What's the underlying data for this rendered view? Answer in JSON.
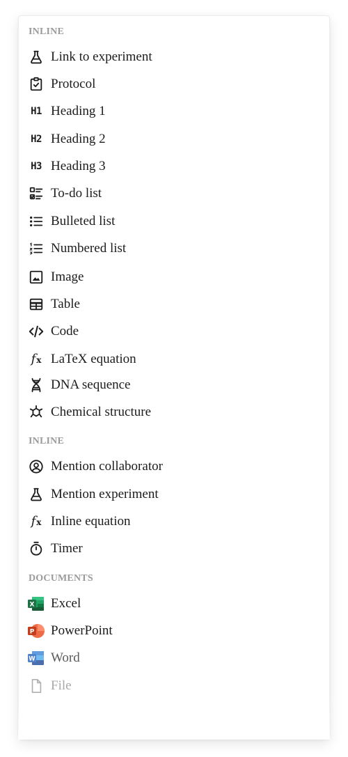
{
  "sections": {
    "inline_1": "INLINE",
    "inline_2": "INLINE",
    "documents": "DOCUMENTS"
  },
  "items": {
    "link_experiment": "Link to experiment",
    "protocol": "Protocol",
    "heading1": "Heading 1",
    "heading2": "Heading 2",
    "heading3": "Heading 3",
    "todo": "To-do list",
    "bulleted": "Bulleted list",
    "numbered": "Numbered list",
    "image": "Image",
    "table": "Table",
    "code": "Code",
    "latex": "LaTeX equation",
    "dna": "DNA sequence",
    "chemical": "Chemical structure",
    "mention_collab": "Mention collaborator",
    "mention_experiment": "Mention experiment",
    "inline_equation": "Inline equation",
    "timer": "Timer",
    "excel": "Excel",
    "powerpoint": "PowerPoint",
    "word": "Word",
    "file": "File"
  },
  "icon_glyphs": {
    "h1": "H1",
    "h2": "H2",
    "h3": "H3",
    "fx": "f",
    "fx_sub": "x",
    "excel_letter": "X",
    "powerpoint_letter": "P",
    "word_letter": "W"
  },
  "colors": {
    "excel": "#1e7145",
    "powerpoint": "#d24726",
    "word": "#2b579a"
  }
}
